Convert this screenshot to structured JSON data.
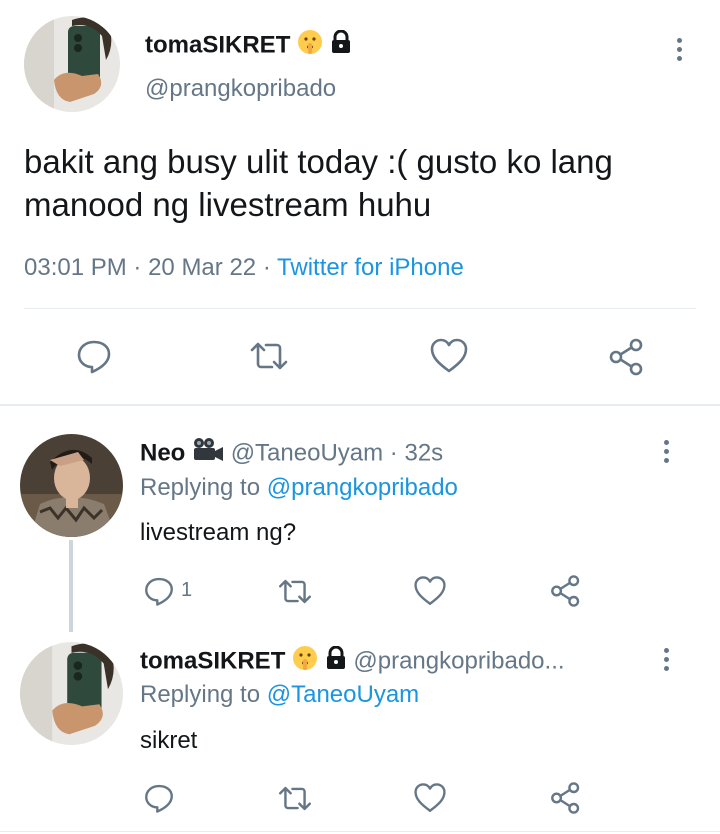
{
  "main_tweet": {
    "display_name": "tomaSIKRET",
    "handle": "@prangkopribado",
    "text": "bakit ang busy ulit today :( gusto ko lang manood ng livestream huhu",
    "time": "03:01 PM",
    "date": "20 Mar 22",
    "source": "Twitter for iPhone",
    "separator": "·"
  },
  "replies": [
    {
      "display_name": "Neo",
      "handle": "@TaneoUyam",
      "age": "32s",
      "replying_label": "Replying to",
      "replying_to": "@prangkopribado",
      "text": "livestream ng?",
      "reply_count": "1"
    },
    {
      "display_name": "tomaSIKRET",
      "handle": "@prangkopribado...",
      "replying_label": "Replying to",
      "replying_to": "@TaneoUyam",
      "text": "sikret"
    }
  ],
  "colors": {
    "text": "#14171a",
    "secondary": "#657786",
    "link": "#1b95e0",
    "divider": "#e6ecf0",
    "thread_line": "#ccd6dd"
  },
  "icons": [
    "shushing-face-emoji",
    "lock-icon",
    "movie-camera-emoji",
    "reply-icon",
    "retweet-icon",
    "like-icon",
    "share-icon",
    "more-icon"
  ]
}
